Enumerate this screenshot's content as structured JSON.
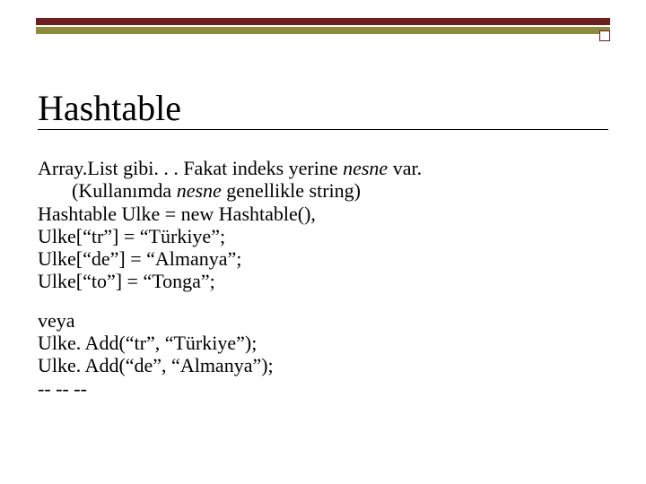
{
  "title": "Hashtable",
  "body": {
    "l1a": "Array.List gibi. . . Fakat indeks yerine ",
    "l1b_em": "nesne",
    "l1c": " var.",
    "l2a": "(Kullanımda ",
    "l2b_em": "nesne",
    "l2c": " genellikle string)",
    "l3": "Hashtable Ulke = new Hashtable(),",
    "l4": "Ulke[“tr”] = “Türkiye”;",
    "l5": "Ulke[“de”] = “Almanya”;",
    "l6": "Ulke[“to”] = “Tonga”;",
    "l7": "veya",
    "l8": "Ulke. Add(“tr”, “Türkiye”);",
    "l9": "Ulke. Add(“de”, “Almanya”);",
    "l10": "-- -- --"
  }
}
